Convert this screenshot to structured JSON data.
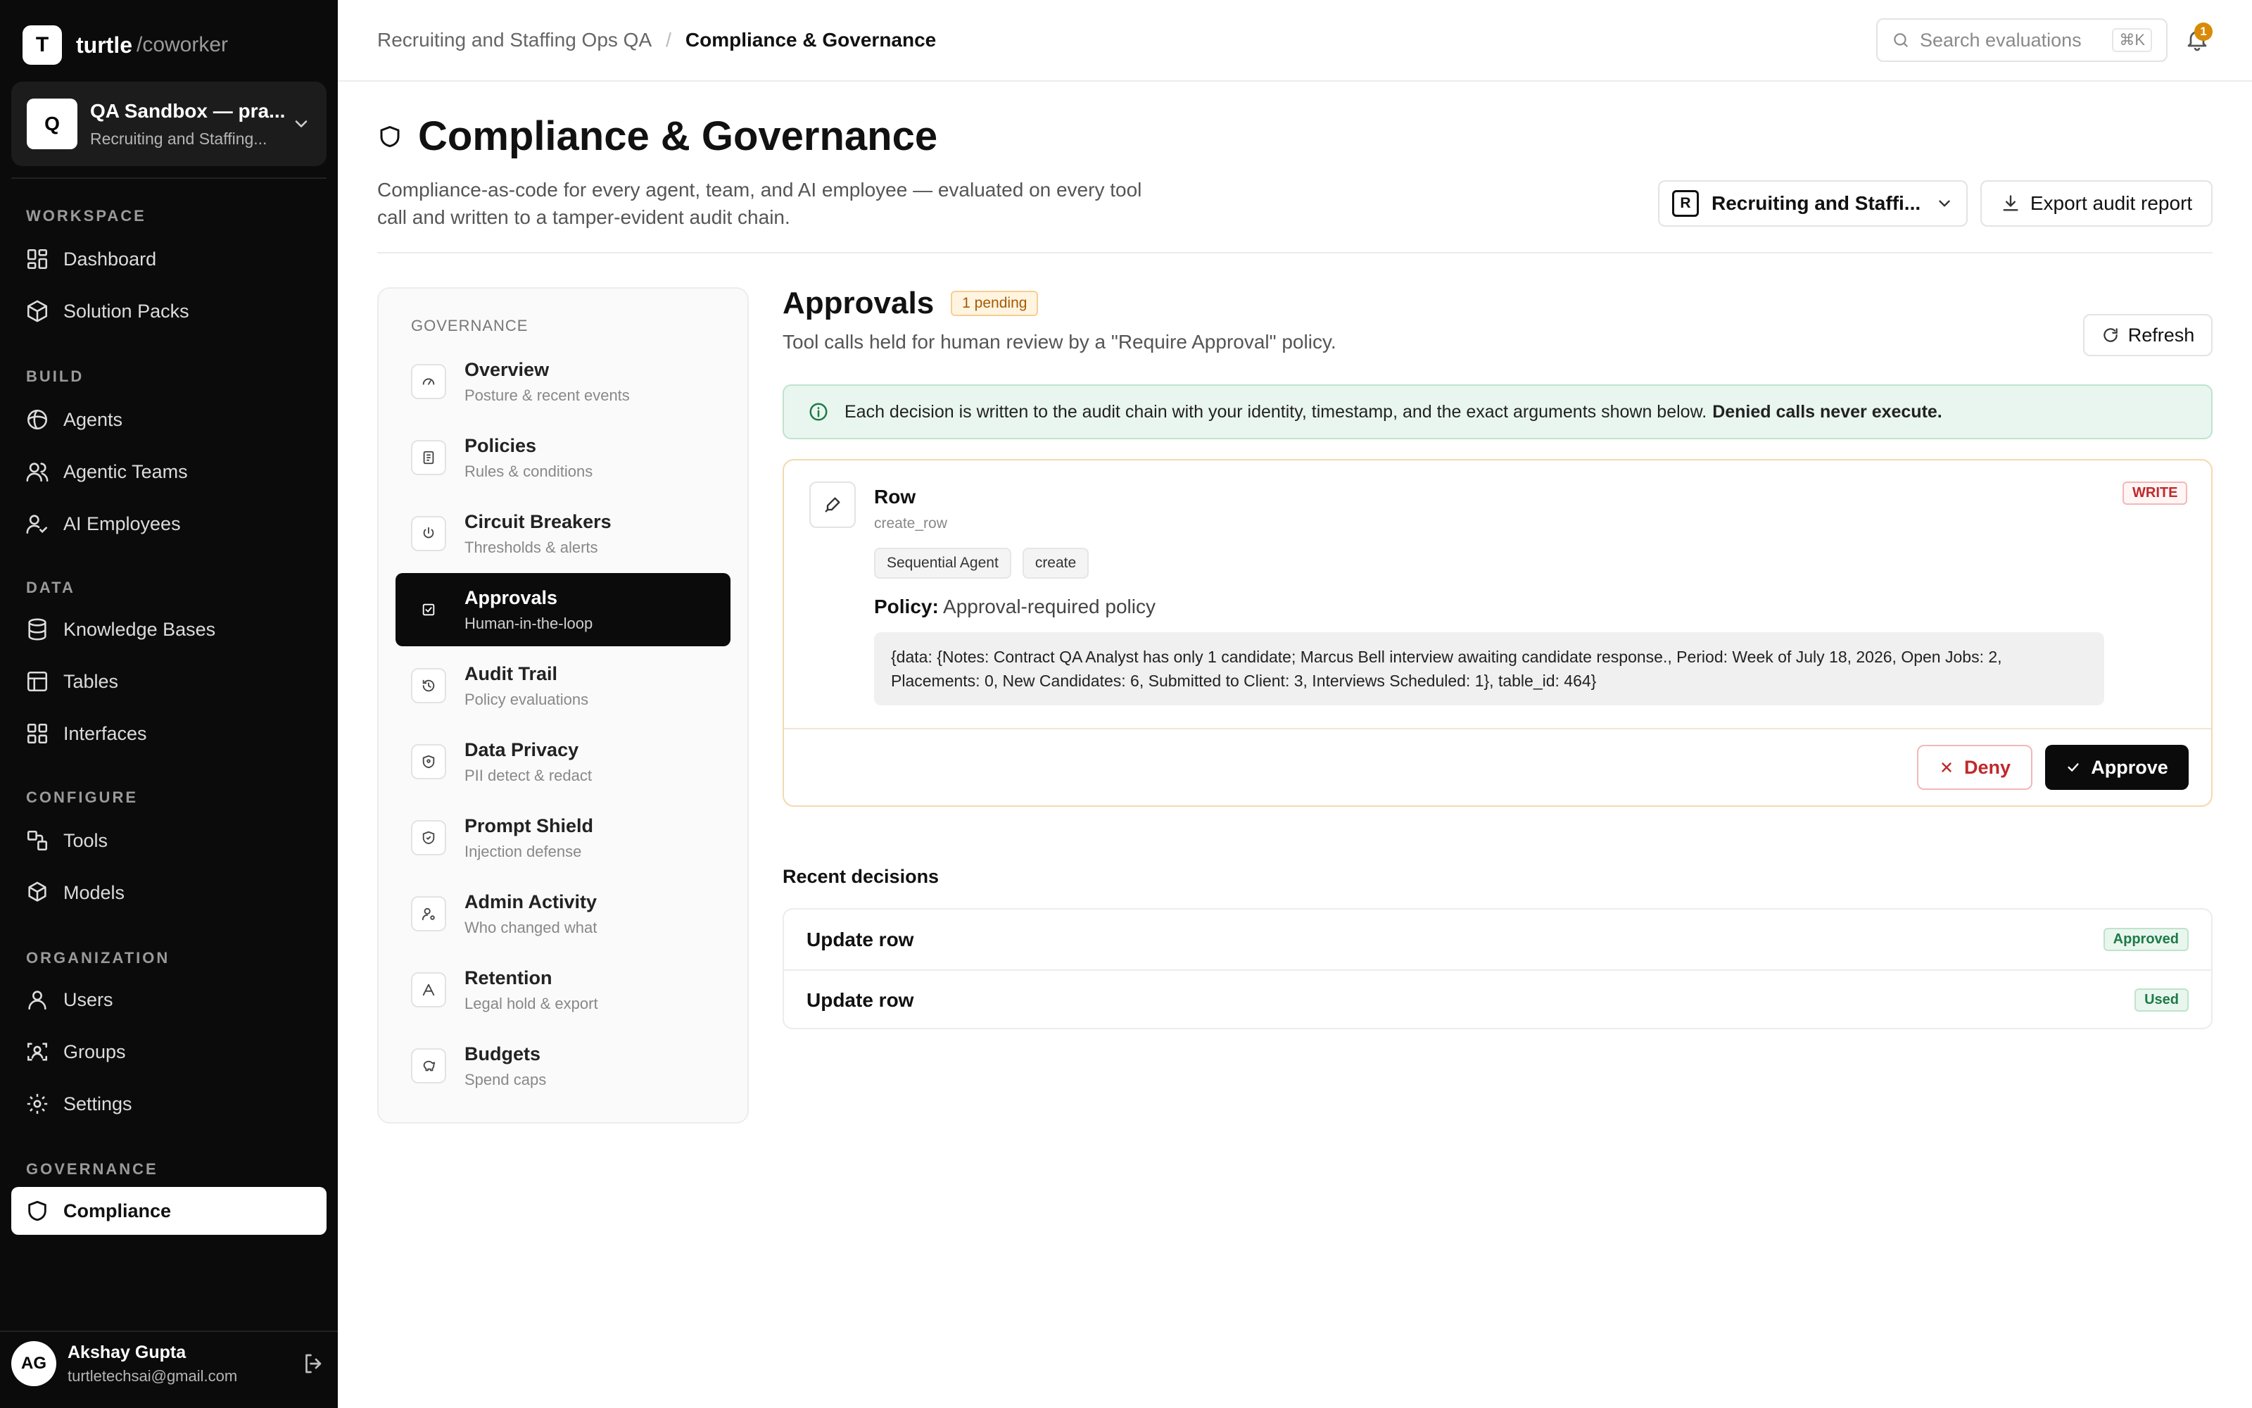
{
  "brand": {
    "logo_letter": "T",
    "name": "turtle",
    "suffix": "/coworker"
  },
  "workspace": {
    "avatar": "Q",
    "title": "QA Sandbox — pra...",
    "subtitle": "Recruiting and Staffing..."
  },
  "nav": {
    "sections": {
      "workspace": "WORKSPACE",
      "build": "BUILD",
      "data": "DATA",
      "configure": "CONFIGURE",
      "organization": "ORGANIZATION",
      "governance": "GOVERNANCE"
    },
    "items": {
      "dashboard": "Dashboard",
      "solution_packs": "Solution Packs",
      "agents": "Agents",
      "agentic_teams": "Agentic Teams",
      "ai_employees": "AI Employees",
      "knowledge_bases": "Knowledge Bases",
      "tables": "Tables",
      "interfaces": "Interfaces",
      "tools": "Tools",
      "models": "Models",
      "users": "Users",
      "groups": "Groups",
      "settings": "Settings",
      "compliance": "Compliance"
    },
    "active": "compliance"
  },
  "user": {
    "initials": "AG",
    "name": "Akshay Gupta",
    "email": "turtletechsai@gmail.com"
  },
  "breadcrumb": {
    "parent": "Recruiting and Staffing Ops QA",
    "separator": "/",
    "current": "Compliance & Governance"
  },
  "search": {
    "placeholder": "Search evaluations",
    "shortcut": "⌘K"
  },
  "notifications": {
    "count": "1"
  },
  "page": {
    "title": "Compliance & Governance",
    "description": "Compliance-as-code for every agent, team, and AI employee — evaluated on every tool call and written to a tamper-evident audit chain.",
    "project_badge": "R",
    "project_select": "Recruiting and Staffi...",
    "export_label": "Export audit report"
  },
  "governance_nav": {
    "heading": "GOVERNANCE",
    "items": [
      {
        "title": "Overview",
        "subtitle": "Posture & recent events",
        "icon": "gauge-icon"
      },
      {
        "title": "Policies",
        "subtitle": "Rules & conditions",
        "icon": "document-icon"
      },
      {
        "title": "Circuit Breakers",
        "subtitle": "Thresholds & alerts",
        "icon": "power-icon"
      },
      {
        "title": "Approvals",
        "subtitle": "Human-in-the-loop",
        "icon": "check-square-icon"
      },
      {
        "title": "Audit Trail",
        "subtitle": "Policy evaluations",
        "icon": "history-icon"
      },
      {
        "title": "Data Privacy",
        "subtitle": "PII detect & redact",
        "icon": "shield-lock-icon"
      },
      {
        "title": "Prompt Shield",
        "subtitle": "Injection defense",
        "icon": "shield-icon"
      },
      {
        "title": "Admin Activity",
        "subtitle": "Who changed what",
        "icon": "user-cog-icon"
      },
      {
        "title": "Retention",
        "subtitle": "Legal hold & export",
        "icon": "archive-icon"
      },
      {
        "title": "Budgets",
        "subtitle": "Spend caps",
        "icon": "piggy-bank-icon"
      }
    ],
    "active_index": 3
  },
  "approvals": {
    "title": "Approvals",
    "pending_badge": "1 pending",
    "subtitle": "Tool calls held for human review by a \"Require Approval\" policy.",
    "refresh_label": "Refresh",
    "info": {
      "text": "Each decision is written to the audit chain with your identity, timestamp, and the exact arguments shown below.",
      "strong": "Denied calls never execute."
    },
    "request": {
      "name": "Row",
      "code": "create_row",
      "badge": "WRITE",
      "tags": [
        "Sequential Agent",
        "create"
      ],
      "policy_label": "Policy:",
      "policy_value": "Approval-required policy",
      "arguments": "{data: {Notes: Contract QA Analyst has only 1 candidate; Marcus Bell interview awaiting candidate response., Period: Week of July 18, 2026, Open Jobs: 2, Placements: 0, New Candidates: 6, Submitted to Client: 3, Interviews Scheduled: 1}, table_id: 464}",
      "deny_label": "Deny",
      "approve_label": "Approve"
    },
    "recent": {
      "heading": "Recent decisions",
      "rows": [
        {
          "label": "Update row",
          "status": "Approved"
        },
        {
          "label": "Update row",
          "status": "Used"
        }
      ]
    }
  }
}
